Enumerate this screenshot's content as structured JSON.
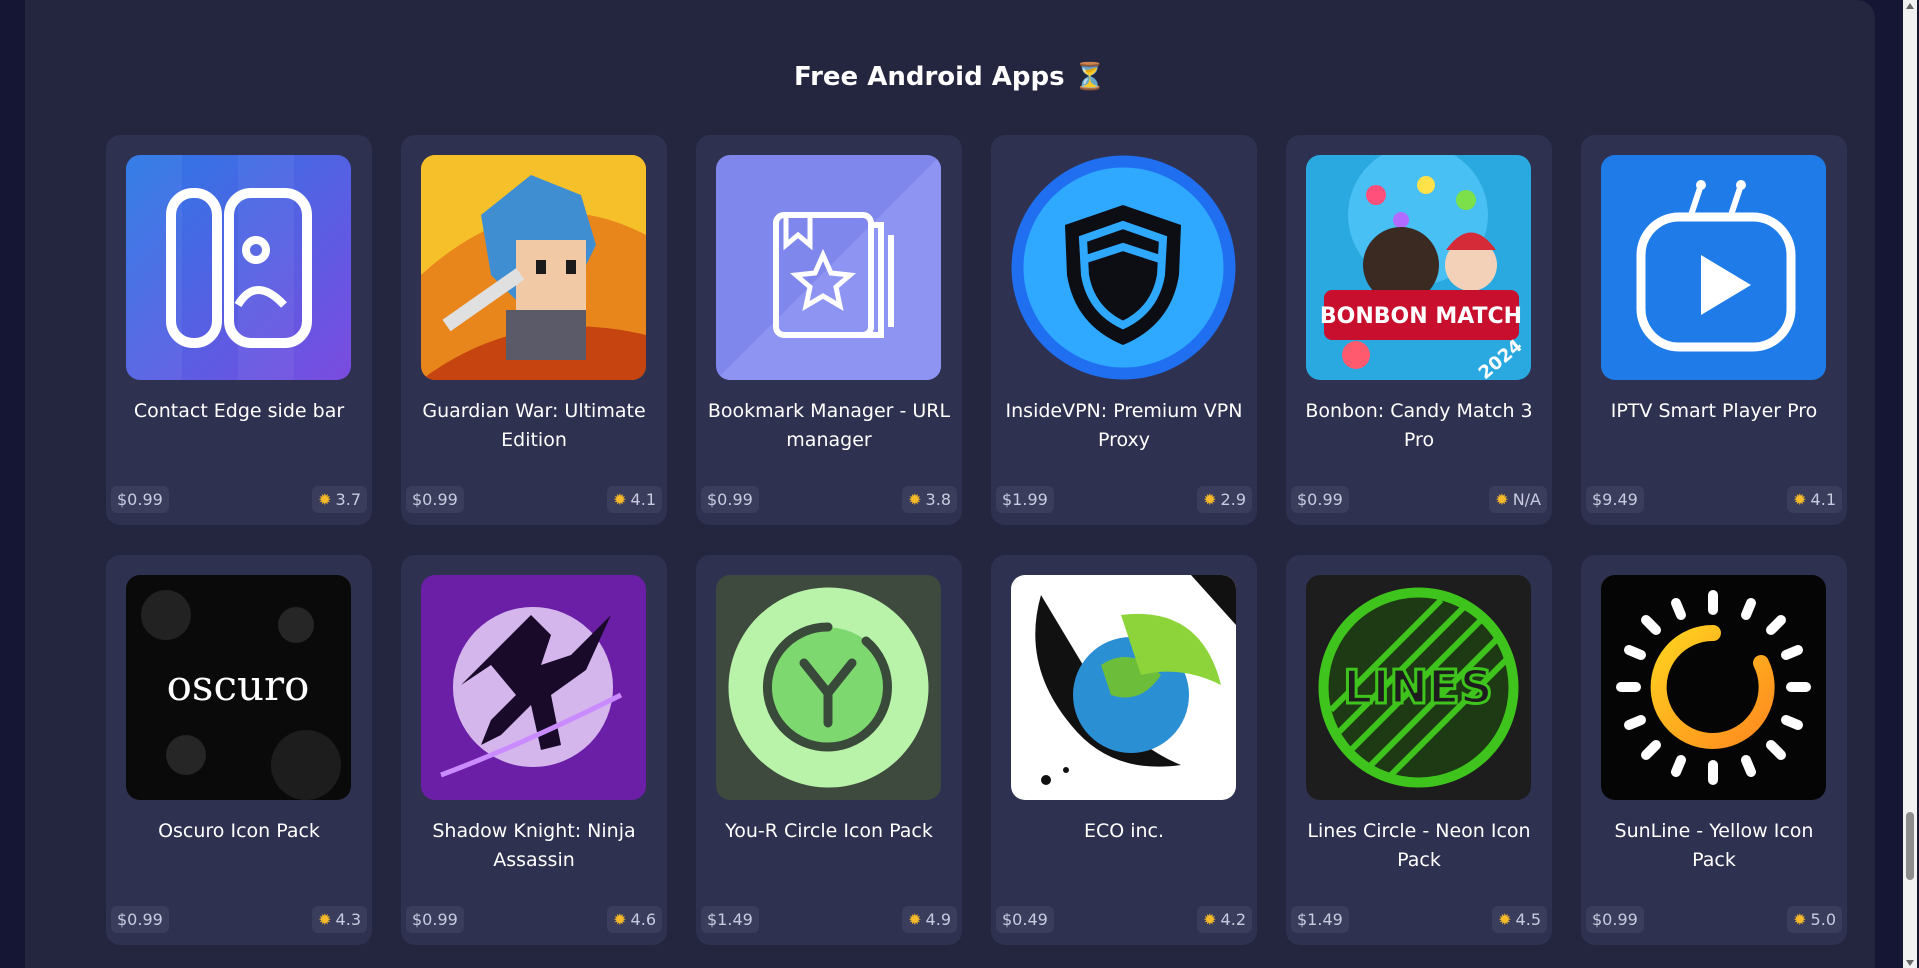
{
  "section": {
    "title": "Free Android Apps ⏳"
  },
  "apps": [
    {
      "name": "Contact Edge side bar",
      "price": "$0.99",
      "rating": "3.7",
      "icon": "contact-edge-icon"
    },
    {
      "name": "Guardian War: Ultimate Edition",
      "price": "$0.99",
      "rating": "4.1",
      "icon": "guardian-war-icon"
    },
    {
      "name": "Bookmark Manager - URL manager",
      "price": "$0.99",
      "rating": "3.8",
      "icon": "bookmark-manager-icon"
    },
    {
      "name": "InsideVPN: Premium VPN Proxy",
      "price": "$1.99",
      "rating": "2.9",
      "icon": "insidevpn-icon"
    },
    {
      "name": "Bonbon: Candy Match 3 Pro",
      "price": "$0.99",
      "rating": "N/A",
      "icon": "bonbon-icon",
      "icon_text": "BONBON MATCH",
      "icon_year": "2024"
    },
    {
      "name": "IPTV Smart Player Pro",
      "price": "$9.49",
      "rating": "4.1",
      "icon": "iptv-player-icon"
    },
    {
      "name": "Oscuro Icon Pack",
      "price": "$0.99",
      "rating": "4.3",
      "icon": "oscuro-icon",
      "icon_text": "oscuro"
    },
    {
      "name": "Shadow Knight: Ninja Assassin",
      "price": "$0.99",
      "rating": "4.6",
      "icon": "shadow-knight-icon"
    },
    {
      "name": "You-R Circle Icon Pack",
      "price": "$1.49",
      "rating": "4.9",
      "icon": "you-r-circle-icon"
    },
    {
      "name": "ECO inc.",
      "price": "$0.49",
      "rating": "4.2",
      "icon": "eco-inc-icon"
    },
    {
      "name": "Lines Circle - Neon Icon Pack",
      "price": "$1.49",
      "rating": "4.5",
      "icon": "lines-circle-icon",
      "icon_text": "LINES"
    },
    {
      "name": "SunLine - Yellow Icon Pack",
      "price": "$0.99",
      "rating": "5.0",
      "icon": "sunline-icon"
    }
  ],
  "colors": {
    "page_bg": "#141633",
    "panel_bg": "#24263f",
    "card_bg": "#2e3150",
    "star": "#f5b92a"
  }
}
